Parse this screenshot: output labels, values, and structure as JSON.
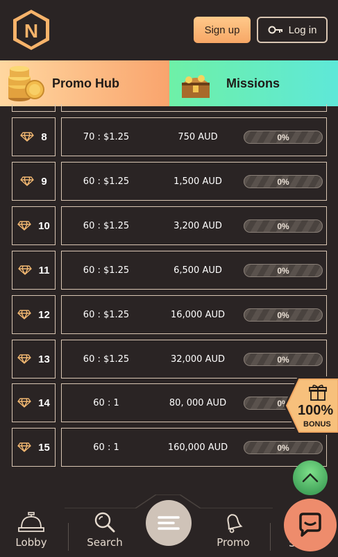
{
  "header": {
    "logo_letter": "N",
    "signup_label": "Sign up",
    "login_label": "Log in"
  },
  "promo": {
    "promo_hub_label": "Promo Hub",
    "missions_label": "Missions"
  },
  "rows": [
    {
      "rank": "8",
      "ratio": "70 : $1.25",
      "prize": "750 AUD",
      "progress": "0%"
    },
    {
      "rank": "9",
      "ratio": "60 : $1.25",
      "prize": "1,500 AUD",
      "progress": "0%"
    },
    {
      "rank": "10",
      "ratio": "60 : $1.25",
      "prize": "3,200 AUD",
      "progress": "0%"
    },
    {
      "rank": "11",
      "ratio": "60 : $1.25",
      "prize": "6,500 AUD",
      "progress": "0%"
    },
    {
      "rank": "12",
      "ratio": "60 : $1.25",
      "prize": "16,000 AUD",
      "progress": "0%"
    },
    {
      "rank": "13",
      "ratio": "60 : $1.25",
      "prize": "32,000 AUD",
      "progress": "0%"
    },
    {
      "rank": "14",
      "ratio": "60 : 1",
      "prize": "80, 000 AUD",
      "progress": "0%"
    },
    {
      "rank": "15",
      "ratio": "60 : 1",
      "prize": "160,000 AUD",
      "progress": "0%"
    }
  ],
  "bonus": {
    "percent": "100%",
    "label": "BONUS"
  },
  "nav": {
    "lobby": "Lobby",
    "search": "Search",
    "promo": "Promo",
    "partial": "S"
  },
  "colors": {
    "background": "#2a2424",
    "accent_orange": "#f7a766",
    "accent_green": "#6ef0a7",
    "border": "#d9c6b3"
  }
}
